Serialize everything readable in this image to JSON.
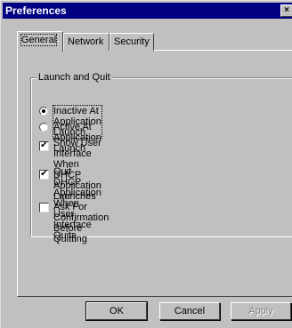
{
  "window": {
    "title": "Preferences",
    "close_glyph": "×"
  },
  "tabs": [
    {
      "label": "General",
      "active": true
    },
    {
      "label": "Network",
      "active": false
    },
    {
      "label": "Security",
      "active": false
    }
  ],
  "group": {
    "label": "Launch and Quit",
    "options": [
      {
        "type": "radio",
        "label": "Inactive At Application Launch",
        "checked": true
      },
      {
        "type": "radio",
        "label": "Active At Application Launch",
        "checked": false
      },
      {
        "type": "checkbox",
        "label": "Show User Interface When DHCP\nApplication Launches",
        "checked": true
      },
      {
        "type": "checkbox",
        "label": "Quit DHCP Application When User\nInterface Quits",
        "checked": true
      },
      {
        "type": "checkbox",
        "label": "Ask For Confirmation Before Quitting",
        "checked": false
      }
    ]
  },
  "buttons": {
    "ok": "OK",
    "cancel": "Cancel",
    "apply": "Apply",
    "apply_enabled": false
  },
  "colors": {
    "titlebar": "#000080",
    "face": "#c0c0c0"
  }
}
